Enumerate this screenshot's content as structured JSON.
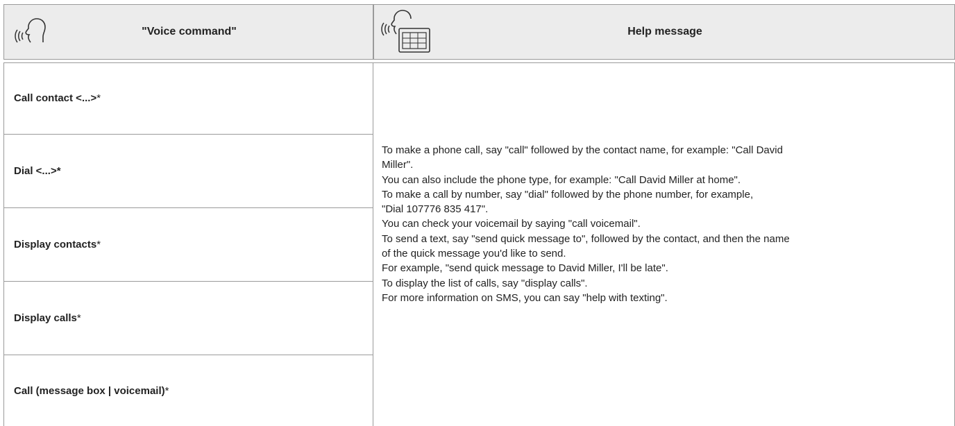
{
  "header": {
    "voice_command_title": "\"Voice command\"",
    "help_message_title": "Help message"
  },
  "commands": [
    {
      "label": "Call contact <...>",
      "suffix": "*"
    },
    {
      "label": "Dial <...>*",
      "suffix": ""
    },
    {
      "label": "Display contacts",
      "suffix": "*"
    },
    {
      "label": "Display calls",
      "suffix": "*"
    },
    {
      "label": "Call (message box | voicemail)",
      "suffix": "*"
    }
  ],
  "help": {
    "lines": [
      "To make a phone call, say \"call\" followed by the contact name, for example: \"Call David",
      "Miller\".",
      "You can also include the phone type, for example: \"Call David Miller at home\".",
      "To make a call by number, say \"dial\" followed by the phone number, for example,",
      "\"Dial 107776 835 417\".",
      "You can check your voicemail by saying \"call voicemail\".",
      "To send a text, say \"send quick message to\", followed by the contact, and then the name",
      "of the quick message you'd like to send.",
      "For example, \"send quick message to David Miller, I'll be late\".",
      "To display the list of calls, say \"display calls\".",
      "For more information on SMS, you can say \"help with texting\"."
    ]
  },
  "icons": {
    "voice": "speaking-head-icon",
    "help": "speaking-head-keypad-icon"
  }
}
